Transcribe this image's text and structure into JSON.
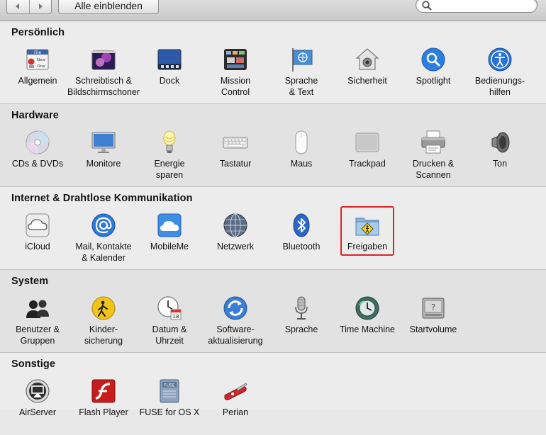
{
  "toolbar": {
    "show_all_label": "Alle einblenden",
    "search": {
      "value": "",
      "placeholder": ""
    }
  },
  "sections": [
    {
      "title": "Persönlich",
      "items": [
        {
          "id": "allgemein",
          "icon": "general-icon",
          "lines": [
            "Allgemein"
          ]
        },
        {
          "id": "schreibtisch",
          "icon": "desktop-screensaver-icon",
          "lines": [
            "Schreibtisch &",
            "Bildschirmschoner"
          ]
        },
        {
          "id": "dock",
          "icon": "dock-icon",
          "lines": [
            "Dock"
          ]
        },
        {
          "id": "mission-control",
          "icon": "mission-control-icon",
          "lines": [
            "Mission",
            "Control"
          ]
        },
        {
          "id": "sprache-text",
          "icon": "language-text-icon",
          "lines": [
            "Sprache",
            "& Text"
          ]
        },
        {
          "id": "sicherheit",
          "icon": "security-icon",
          "lines": [
            "Sicherheit"
          ]
        },
        {
          "id": "spotlight",
          "icon": "spotlight-icon",
          "lines": [
            "Spotlight"
          ]
        },
        {
          "id": "bedienungshilfen",
          "icon": "accessibility-icon",
          "lines": [
            "Bedienungs-",
            "hilfen"
          ]
        }
      ]
    },
    {
      "title": "Hardware",
      "items": [
        {
          "id": "cds-dvds",
          "icon": "cd-dvd-icon",
          "lines": [
            "CDs & DVDs"
          ]
        },
        {
          "id": "monitore",
          "icon": "monitor-icon",
          "lines": [
            "Monitore"
          ]
        },
        {
          "id": "energie-sparen",
          "icon": "energy-saver-icon",
          "lines": [
            "Energie",
            "sparen"
          ]
        },
        {
          "id": "tastatur",
          "icon": "keyboard-icon",
          "lines": [
            "Tastatur"
          ]
        },
        {
          "id": "maus",
          "icon": "mouse-icon",
          "lines": [
            "Maus"
          ]
        },
        {
          "id": "trackpad",
          "icon": "trackpad-icon",
          "lines": [
            "Trackpad"
          ]
        },
        {
          "id": "drucken-scannen",
          "icon": "printer-icon",
          "lines": [
            "Drucken &",
            "Scannen"
          ]
        },
        {
          "id": "ton",
          "icon": "sound-icon",
          "lines": [
            "Ton"
          ]
        }
      ]
    },
    {
      "title": "Internet & Drahtlose Kommunikation",
      "items": [
        {
          "id": "icloud",
          "icon": "icloud-icon",
          "lines": [
            "iCloud"
          ]
        },
        {
          "id": "mail-kontakte",
          "icon": "mail-contacts-icon",
          "lines": [
            "Mail, Kontakte",
            "& Kalender"
          ]
        },
        {
          "id": "mobileme",
          "icon": "mobileme-icon",
          "lines": [
            "MobileMe"
          ]
        },
        {
          "id": "netzwerk",
          "icon": "network-icon",
          "lines": [
            "Netzwerk"
          ]
        },
        {
          "id": "bluetooth",
          "icon": "bluetooth-icon",
          "lines": [
            "Bluetooth"
          ]
        },
        {
          "id": "freigaben",
          "icon": "sharing-folder-icon",
          "lines": [
            "Freigaben"
          ]
        }
      ]
    },
    {
      "title": "System",
      "items": [
        {
          "id": "benutzer-gruppen",
          "icon": "users-groups-icon",
          "lines": [
            "Benutzer &",
            "Gruppen"
          ]
        },
        {
          "id": "kindersicherung",
          "icon": "parental-controls-icon",
          "lines": [
            "Kinder-",
            "sicherung"
          ]
        },
        {
          "id": "datum-uhrzeit",
          "icon": "date-time-icon",
          "lines": [
            "Datum &",
            "Uhrzeit"
          ]
        },
        {
          "id": "softwareaktualisierung",
          "icon": "software-update-icon",
          "lines": [
            "Software-",
            "aktualisierung"
          ]
        },
        {
          "id": "sprache",
          "icon": "speech-icon",
          "lines": [
            "Sprache"
          ]
        },
        {
          "id": "time-machine",
          "icon": "time-machine-icon",
          "lines": [
            "Time Machine"
          ]
        },
        {
          "id": "startvolume",
          "icon": "startup-disk-icon",
          "lines": [
            "Startvolume"
          ]
        }
      ]
    },
    {
      "title": "Sonstige",
      "items": [
        {
          "id": "airserver",
          "icon": "airserver-icon",
          "lines": [
            "AirServer"
          ]
        },
        {
          "id": "flash-player",
          "icon": "flash-player-icon",
          "lines": [
            "Flash Player"
          ]
        },
        {
          "id": "fuse",
          "icon": "fuse-icon",
          "lines": [
            "FUSE for OS X"
          ]
        },
        {
          "id": "perian",
          "icon": "perian-icon",
          "lines": [
            "Perian"
          ]
        }
      ]
    }
  ],
  "highlighted_item": "freigaben",
  "colors": {
    "highlight": "#e0202a"
  },
  "icon_text": {
    "general_file": "File",
    "general_new": "New",
    "general_open": "One",
    "date_day": "18",
    "fuse_label": "FUSE"
  }
}
